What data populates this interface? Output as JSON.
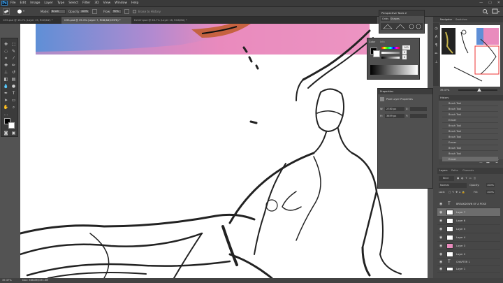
{
  "app": {
    "logo": "Ps"
  },
  "menu": [
    "File",
    "Edit",
    "Image",
    "Layer",
    "Type",
    "Select",
    "Filter",
    "3D",
    "View",
    "Window",
    "Help"
  ],
  "window_controls": [
    "—",
    "▢",
    "✕"
  ],
  "options": {
    "mode_label": "Mode:",
    "mode_value": "Brush",
    "opacity_label": "Opacity:",
    "opacity_value": "100%",
    "flow_label": "Flow:",
    "flow_value": "90%",
    "history_label": "Erase to History"
  },
  "tabs": [
    {
      "label": "CHS.psd @ 16.2% (Layer 15, RGB/8#) *",
      "active": false
    },
    {
      "label": "CHS.psd @ 39.4% (Layer 7, RGB/8#/CMYK) *",
      "active": true
    },
    {
      "label": "ExSCH.psd @ 66.7% (Layer 16, RGB/8#) *",
      "active": false
    }
  ],
  "perspective_panel": {
    "title": "Perspective Tools 2",
    "tabs": [
      "Grids",
      "Shapes"
    ]
  },
  "color_panel": {
    "tabs": [
      "Color",
      "Info"
    ],
    "values": [
      "100",
      "0",
      "0"
    ]
  },
  "properties_panel": {
    "title": "Properties",
    "subtitle": "Pixel Layer Properties",
    "w_label": "W:",
    "w_value": "2780 px",
    "h_label": "H:",
    "h_value": "3659 px",
    "x_label": "X:",
    "y_label": "Y:"
  },
  "navigator_panel": {
    "tabs": [
      "Navigator",
      "Swatches"
    ],
    "zoom": "39.37%"
  },
  "history_panel": {
    "title": "History",
    "items": [
      "Brush Tool",
      "Brush Tool",
      "Brush Tool",
      "Eraser",
      "Brush Tool",
      "Brush Tool",
      "Brush Tool",
      "Eraser",
      "Brush Tool",
      "Brush Tool",
      "Eraser"
    ]
  },
  "layers_panel": {
    "tabs": [
      "Layers",
      "Paths",
      "Channels"
    ],
    "kind_label": "Kind",
    "blend_mode": "Normal",
    "opacity_label": "Opacity:",
    "opacity_value": "100%",
    "lock_label": "Lock:",
    "fill_label": "Fill:",
    "fill_value": "100%",
    "layers": [
      {
        "name": "BREAKDOWN OF A POSE",
        "type": "text"
      },
      {
        "name": "Layer 7",
        "type": "pixel",
        "selected": true
      },
      {
        "name": "Layer 6",
        "type": "pixel"
      },
      {
        "name": "Layer 5",
        "type": "pixel"
      },
      {
        "name": "Layer 4",
        "type": "pixel"
      },
      {
        "name": "Layer 3",
        "type": "pixel"
      },
      {
        "name": "Layer 2",
        "type": "pixel"
      },
      {
        "name": "CHAPTER 1",
        "type": "group"
      },
      {
        "name": "Layer 1",
        "type": "pixel"
      }
    ]
  },
  "status": {
    "zoom": "39.37%",
    "doc": "Doc: 366.8M/191.3M"
  },
  "colors": {
    "accent": "#2d8ceb",
    "canvas_gradient": [
      "#5f8fd6",
      "#e98bbd",
      "#f0a0c8"
    ]
  }
}
